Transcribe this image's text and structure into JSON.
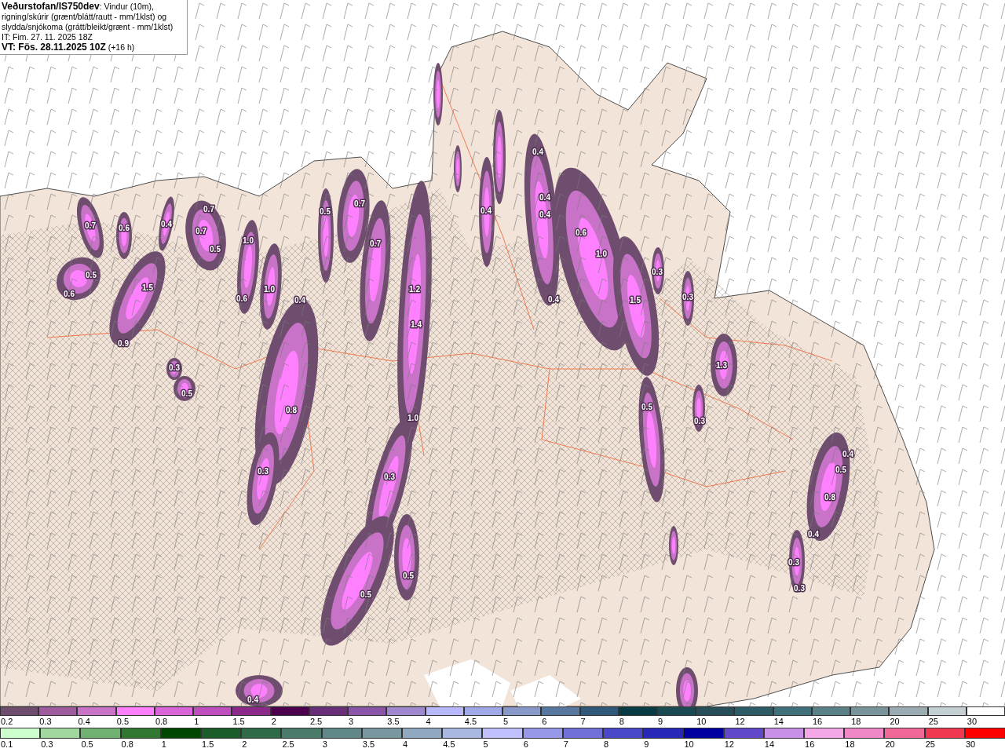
{
  "header": {
    "description": "**Veðurstofan/IS750dev**: Vindur (10m), rigning/skúrir (grænt/blátt/rautt - mm/1klst) og slydda/snjókoma (grátt/bleikt/grænt - mm/1klst)",
    "issue_time": "IT: Fim. 27. 11. 2025 18Z",
    "valid_time": "**VT: Fös. 28.11.2025 10Z** (+16 h)"
  },
  "map": {
    "contour_labels": [
      "0.7",
      "0.6",
      "0.4",
      "0.7",
      "0.7",
      "0.5",
      "1.0",
      "0.5",
      "0.6",
      "1.5",
      "0.9",
      "0.3",
      "0.5",
      "0.6",
      "1.0",
      "0.4",
      "0.8",
      "0.3",
      "0.5",
      "0.7",
      "0.7",
      "1.2",
      "1.4",
      "1.0",
      "0.3",
      "0.5",
      "0.5",
      "0.4",
      "0.4",
      "0.4",
      "0.4",
      "0.4",
      "0.4",
      "0.6",
      "1.0",
      "1.5",
      "0.3",
      "0.3",
      "1.3",
      "0.3",
      "0.5",
      "0.4",
      "0.5",
      "0.8",
      "0.4",
      "0.3",
      "0.3"
    ]
  },
  "legends": [
    {
      "kind": "snow",
      "items": [
        {
          "label": "0.2",
          "color": "#6e4d6e"
        },
        {
          "label": "0.3",
          "color": "#9e5c9e"
        },
        {
          "label": "0.4",
          "color": "#c873c8"
        },
        {
          "label": "0.5",
          "color": "#ff80ff"
        },
        {
          "label": "0.8",
          "color": "#d966d9"
        },
        {
          "label": "1",
          "color": "#bf4fbf"
        },
        {
          "label": "1.5",
          "color": "#8c2a8c"
        },
        {
          "label": "2",
          "color": "#4d004d"
        },
        {
          "label": "2.5",
          "color": "#6a2d7a"
        },
        {
          "label": "3",
          "color": "#8a55a8"
        },
        {
          "label": "3.5",
          "color": "#a088d0"
        },
        {
          "label": "4",
          "color": "#b8b8ff"
        },
        {
          "label": "4.5",
          "color": "#a0a8e8"
        },
        {
          "label": "5",
          "color": "#8898c8"
        },
        {
          "label": "6",
          "color": "#5878a0"
        },
        {
          "label": "7",
          "color": "#30587a"
        },
        {
          "label": "8",
          "color": "#083c44"
        },
        {
          "label": "9",
          "color": "#1a4a52"
        },
        {
          "label": "10",
          "color": "#264e58"
        },
        {
          "label": "12",
          "color": "#2e5c66"
        },
        {
          "label": "14",
          "color": "#40707a"
        },
        {
          "label": "16",
          "color": "#5a8088"
        },
        {
          "label": "18",
          "color": "#78949a"
        },
        {
          "label": "20",
          "color": "#9aacb2"
        },
        {
          "label": "25",
          "color": "#c5d0d5"
        },
        {
          "label": "30",
          "color": "#ffffff"
        }
      ]
    },
    {
      "kind": "rain",
      "items": [
        {
          "label": "0.1",
          "color": "#ccffcc"
        },
        {
          "label": "0.3",
          "color": "#a0d8a0"
        },
        {
          "label": "0.5",
          "color": "#70b070"
        },
        {
          "label": "0.8",
          "color": "#307830"
        },
        {
          "label": "1",
          "color": "#004800"
        },
        {
          "label": "1.5",
          "color": "#1a5c2a"
        },
        {
          "label": "2",
          "color": "#2e6a48"
        },
        {
          "label": "2.5",
          "color": "#4a7a6a"
        },
        {
          "label": "3",
          "color": "#608888"
        },
        {
          "label": "3.5",
          "color": "#7898a0"
        },
        {
          "label": "4",
          "color": "#90a8c0"
        },
        {
          "label": "4.5",
          "color": "#a8b8e0"
        },
        {
          "label": "5",
          "color": "#c0c0ff"
        },
        {
          "label": "6",
          "color": "#9898e8"
        },
        {
          "label": "7",
          "color": "#7070d8"
        },
        {
          "label": "8",
          "color": "#4848c8"
        },
        {
          "label": "9",
          "color": "#2828b8"
        },
        {
          "label": "10",
          "color": "#0000a0"
        },
        {
          "label": "12",
          "color": "#6048c8"
        },
        {
          "label": "14",
          "color": "#c890e8"
        },
        {
          "label": "16",
          "color": "#f4a8e8"
        },
        {
          "label": "18",
          "color": "#f088c8"
        },
        {
          "label": "20",
          "color": "#f06898"
        },
        {
          "label": "25",
          "color": "#f03850"
        },
        {
          "label": "30",
          "color": "#ff0000"
        }
      ]
    }
  ]
}
